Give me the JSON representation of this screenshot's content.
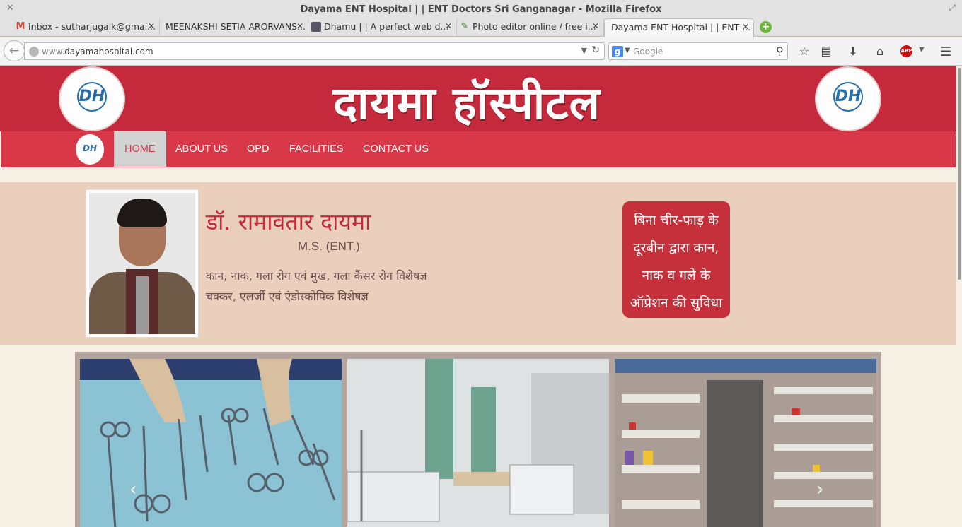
{
  "window": {
    "title": "Dayama ENT Hospital | | ENT Doctors Sri Ganganagar - Mozilla Firefox"
  },
  "tabs": [
    {
      "label": "Inbox - sutharjugalk@gmai...",
      "icon": "gmail-icon"
    },
    {
      "label": "MEENAKSHI SETIA ARORVANS...",
      "icon": ""
    },
    {
      "label": "Dhamu | | A perfect web d...",
      "icon": "profile-icon"
    },
    {
      "label": "Photo editor online / free i...",
      "icon": "pencil-icon"
    },
    {
      "label": "Dayama ENT Hospital | | ENT ...",
      "icon": ""
    }
  ],
  "navbar": {
    "url_prefix": "www.",
    "url_domain": "dayamahospital.com",
    "search_placeholder": "Google"
  },
  "site": {
    "title": "दायमा हॉस्पीटल",
    "logo_text": "DH",
    "nav": [
      {
        "label": "HOME",
        "active": true
      },
      {
        "label": "ABOUT US"
      },
      {
        "label": "OPD"
      },
      {
        "label": "FACILITIES"
      },
      {
        "label": "CONTACT US"
      }
    ]
  },
  "doctor": {
    "name": "डॉ. रामावतार दायमा",
    "degree": "M.S. (ENT.)",
    "line1": "कान, नाक, गला रोग एवं मुख, गला कैंसर रोग विशेषज्ञ",
    "line2": "चक्कर, एलर्जी एवं एंडोस्कोपिक विशेषज्ञ"
  },
  "promo": {
    "lines": [
      "बिना चीर-फाड़ के",
      "दूरबीन द्वारा कान,",
      "नाक व गले के",
      "ऑप्रेशन की सुविधा"
    ]
  },
  "colors": {
    "brand_red": "#c42a3b",
    "nav_red": "#d93848",
    "profile_bg": "#ebcfbd",
    "page_bg": "#f6efe4"
  }
}
